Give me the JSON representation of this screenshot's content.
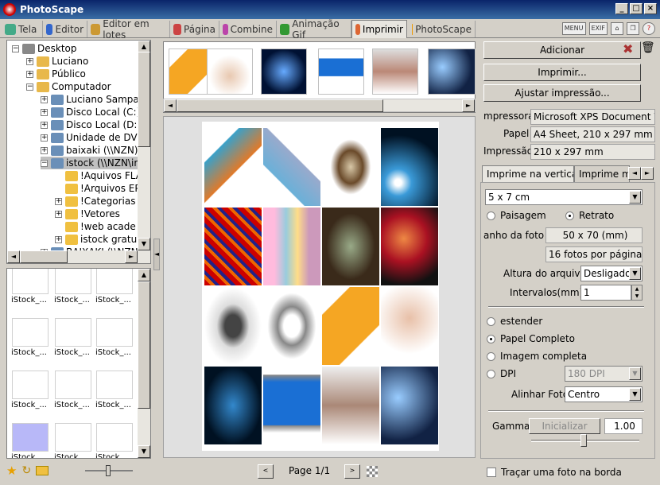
{
  "window": {
    "title": "PhotoScape"
  },
  "tabs": [
    {
      "label": "Tela",
      "color": "#4a8"
    },
    {
      "label": "Editor",
      "color": "#36c"
    },
    {
      "label": "Editor em lotes",
      "color": "#c93"
    },
    {
      "label": "Página",
      "color": "#c44"
    },
    {
      "label": "Combine",
      "color": "#b4a"
    },
    {
      "label": "Animação Gif",
      "color": "#393"
    },
    {
      "label": "Imprimir",
      "color": "#d63"
    },
    {
      "label": "PhotoScape",
      "color": "#e90"
    }
  ],
  "topbar": {
    "menu_label": "MENU",
    "exif_label": "EXIF"
  },
  "tree": {
    "items": [
      {
        "label": "Desktop",
        "indent": 0,
        "exp": "−"
      },
      {
        "label": "Luciano",
        "indent": 1,
        "exp": "+"
      },
      {
        "label": "Público",
        "indent": 1,
        "exp": "+"
      },
      {
        "label": "Computador",
        "indent": 1,
        "exp": "−"
      },
      {
        "label": "Luciano Sampai",
        "indent": 2,
        "exp": "+"
      },
      {
        "label": "Disco Local (C:)",
        "indent": 2,
        "exp": "+"
      },
      {
        "label": "Disco Local (D:)",
        "indent": 2,
        "exp": "+"
      },
      {
        "label": "Unidade de DVD",
        "indent": 2,
        "exp": "+"
      },
      {
        "label": "baixaki (\\\\NZN)",
        "indent": 2,
        "exp": "+"
      },
      {
        "label": "istock (\\\\NZN\\ir",
        "indent": 2,
        "exp": "−"
      },
      {
        "label": "!Aquivos FLA",
        "indent": 3,
        "exp": ""
      },
      {
        "label": "!Arquivos EP",
        "indent": 3,
        "exp": ""
      },
      {
        "label": "!Categorias",
        "indent": 3,
        "exp": "+"
      },
      {
        "label": "!Vetores",
        "indent": 3,
        "exp": "+"
      },
      {
        "label": "!web acade",
        "indent": 3,
        "exp": ""
      },
      {
        "label": "istock gratu",
        "indent": 3,
        "exp": "+"
      },
      {
        "label": "BAIXAKI (\\\\NZN",
        "indent": 2,
        "exp": "+"
      }
    ]
  },
  "thumbs": {
    "label": "iStock_..."
  },
  "print": {
    "add_button": "Adicionar",
    "print_button": "Imprimir...",
    "adjust_button": "Ajustar impressão...",
    "printer_label": "mpressora",
    "printer_value": "Microsoft XPS Document Wr",
    "paper_label": "Papel",
    "paper_value": "A4 Sheet, 210 x 297 mm",
    "print_label": "Impressão",
    "print_value": "210 x 297 mm",
    "tab_vertical": "Imprime na vertical",
    "tab_other": "Imprime mi",
    "size_select": "5 x 7 cm",
    "landscape": "Paisagem",
    "portrait": "Retrato",
    "photo_size_label": "anho da foto",
    "photo_size_value": "50 x 70 (mm)",
    "per_page": "16 fotos por página",
    "file_height_label": "Altura do arquivo",
    "file_height_value": "Desligado",
    "intervals_label": "Intervalos(mm)",
    "intervals_value": "1",
    "stretch": "estender",
    "full_paper": "Papel Completo",
    "full_image": "Imagem completa",
    "dpi": "DPI",
    "dpi_value": "180 DPI",
    "align_label": "Alinhar Foto",
    "align_value": "Centro",
    "gamma_label": "Gamma",
    "gamma_reset": "Inicializar",
    "gamma_value": "1.00",
    "border_checkbox": "Traçar uma foto na borda"
  },
  "pager": {
    "label": "Page 1/1"
  }
}
